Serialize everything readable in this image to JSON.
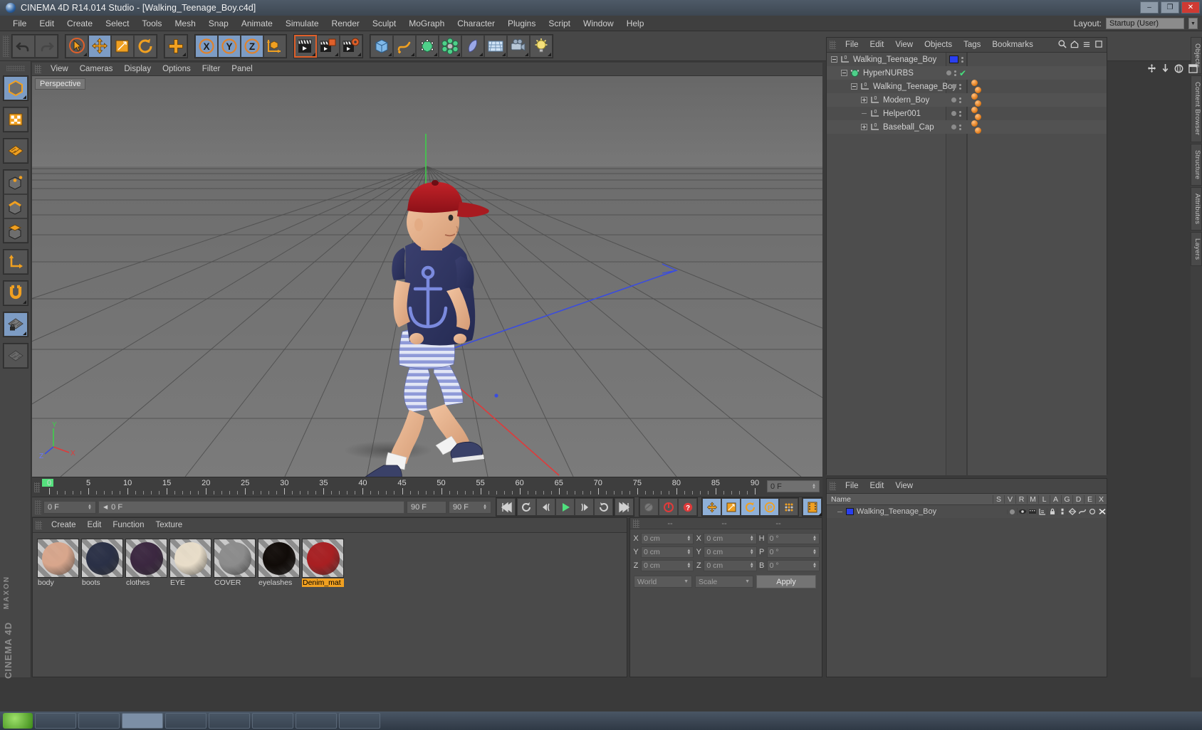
{
  "window": {
    "title": "CINEMA 4D R14.014 Studio - [Walking_Teenage_Boy.c4d]",
    "minimize": "–",
    "maximize": "❐",
    "close": "✕"
  },
  "menubar": {
    "items": [
      "File",
      "Edit",
      "Create",
      "Select",
      "Tools",
      "Mesh",
      "Snap",
      "Animate",
      "Simulate",
      "Render",
      "Sculpt",
      "MoGraph",
      "Character",
      "Plugins",
      "Script",
      "Window",
      "Help"
    ],
    "layout_label": "Layout:",
    "layout_value": "Startup (User)"
  },
  "toolbar": {
    "groups": [
      {
        "name": "history",
        "buttons": [
          {
            "name": "undo-button",
            "icon": "undo"
          },
          {
            "name": "redo-button",
            "icon": "redo"
          }
        ]
      },
      {
        "name": "transform",
        "buttons": [
          {
            "name": "live-selection-tool",
            "icon": "cursor",
            "state": "active"
          },
          {
            "name": "move-tool",
            "icon": "move",
            "state": "selected"
          },
          {
            "name": "scale-tool",
            "icon": "scale"
          },
          {
            "name": "rotate-tool",
            "icon": "rotate"
          }
        ]
      },
      {
        "name": "plus",
        "buttons": [
          {
            "name": "add-tool",
            "icon": "plus"
          }
        ]
      },
      {
        "name": "axis-locks",
        "buttons": [
          {
            "name": "lock-x-axis",
            "icon": "X",
            "state": "selected"
          },
          {
            "name": "lock-y-axis",
            "icon": "Y",
            "state": "selected"
          },
          {
            "name": "lock-z-axis",
            "icon": "Z",
            "state": "selected"
          },
          {
            "name": "world-object-coordinates",
            "icon": "axis-cube"
          }
        ]
      },
      {
        "name": "render",
        "buttons": [
          {
            "name": "render-view-button",
            "icon": "clapper",
            "state": "active"
          },
          {
            "name": "render-region-button",
            "icon": "clapper-region"
          },
          {
            "name": "render-settings-button",
            "icon": "clapper-gear"
          }
        ]
      },
      {
        "name": "objects",
        "buttons": [
          {
            "name": "add-cube-object",
            "icon": "cube"
          },
          {
            "name": "add-spline-object",
            "icon": "spline"
          },
          {
            "name": "add-hypernurbs-object",
            "icon": "nurbs-cube"
          },
          {
            "name": "add-array-object",
            "icon": "array"
          },
          {
            "name": "add-bend-deformer",
            "icon": "deformer"
          },
          {
            "name": "add-floor-object",
            "icon": "floor"
          },
          {
            "name": "add-camera-object",
            "icon": "camera"
          },
          {
            "name": "add-light-object",
            "icon": "light"
          }
        ]
      }
    ]
  },
  "lefttoolbar": {
    "groups": [
      [
        {
          "name": "model-mode",
          "icon": "cube-model",
          "state": "selected"
        }
      ],
      [
        {
          "name": "texture-mode",
          "icon": "checker"
        }
      ],
      [
        {
          "name": "workplane-mode",
          "icon": "grid-plane"
        }
      ],
      [
        {
          "name": "points-mode",
          "icon": "points"
        },
        {
          "name": "edges-mode",
          "icon": "edges"
        },
        {
          "name": "polygons-mode",
          "icon": "polygons"
        }
      ],
      [
        {
          "name": "enable-axis-modification",
          "icon": "axis"
        }
      ],
      [
        {
          "name": "enable-snapping",
          "icon": "magnet"
        }
      ],
      [
        {
          "name": "workplane-lock",
          "icon": "grid-lock",
          "state": "selected"
        }
      ],
      [
        {
          "name": "workplane-grid",
          "icon": "grid"
        }
      ]
    ]
  },
  "viewport": {
    "menus": [
      "View",
      "Cameras",
      "Display",
      "Options",
      "Filter",
      "Panel"
    ],
    "label": "Perspective",
    "icons": [
      "pan-icon",
      "zoom-icon",
      "orbit-icon",
      "maximize-viewport-icon"
    ],
    "axis_labels": {
      "x": "X",
      "y": "Y",
      "z": "Z"
    }
  },
  "object_manager": {
    "menus": [
      "File",
      "Edit",
      "View",
      "Objects",
      "Tags",
      "Bookmarks"
    ],
    "header_icons": [
      "search-icon",
      "home-icon",
      "collapse-icon",
      "menu-icon"
    ],
    "rows": [
      {
        "name": "Walking_Teenage_Boy",
        "depth": 0,
        "expander": "minus",
        "icon": "null",
        "color_swatch": "#2a3ff0",
        "tags": 0
      },
      {
        "name": "HyperNURBS",
        "depth": 1,
        "expander": "minus",
        "icon": "hypernurbs",
        "check": true,
        "tags": 0
      },
      {
        "name": "Walking_Teenage_Boy",
        "depth": 2,
        "expander": "minus",
        "icon": "null",
        "tags": 2
      },
      {
        "name": "Modern_Boy",
        "depth": 3,
        "expander": "plus",
        "icon": "null",
        "tags": 2
      },
      {
        "name": "Helper001",
        "depth": 3,
        "expander": "none",
        "icon": "null",
        "tags": 2
      },
      {
        "name": "Baseball_Cap",
        "depth": 3,
        "expander": "plus",
        "icon": "null",
        "tags": 2
      }
    ]
  },
  "layer_manager": {
    "menus": [
      "File",
      "Edit",
      "View"
    ],
    "columns": [
      "Name",
      "S",
      "V",
      "R",
      "M",
      "L",
      "A",
      "G",
      "D",
      "E",
      "X"
    ],
    "rows": [
      {
        "name": "Walking_Teenage_Boy",
        "color": "#2a3ff0"
      }
    ]
  },
  "timeline": {
    "ticks": [
      0,
      5,
      10,
      15,
      20,
      25,
      30,
      35,
      40,
      45,
      50,
      55,
      60,
      65,
      70,
      75,
      80,
      85,
      90
    ],
    "start": 0,
    "end": 90,
    "end_field": "0 F"
  },
  "animation_bar": {
    "current_frame": "0 F",
    "preview_range_start": "0 F",
    "preview_range_end": "90 F",
    "max_frame": "90 F",
    "buttons": [
      {
        "name": "go-to-start-button",
        "icon": "skip-back"
      },
      {
        "name": "play-backwards-button",
        "icon": "rewind"
      },
      {
        "name": "previous-frame-button",
        "icon": "step-back"
      },
      {
        "name": "play-button",
        "icon": "play"
      },
      {
        "name": "next-frame-button",
        "icon": "step-forward"
      },
      {
        "name": "play-forwards-button",
        "icon": "forward"
      },
      {
        "name": "go-to-end-button",
        "icon": "skip-forward"
      },
      {
        "name": "record-active-objects-button",
        "icon": "keyframe"
      },
      {
        "name": "autokeying-button",
        "icon": "autokey"
      },
      {
        "name": "keyframe-selection-button",
        "icon": "question"
      },
      {
        "name": "position-key-toggle",
        "icon": "move"
      },
      {
        "name": "scale-key-toggle",
        "icon": "scale"
      },
      {
        "name": "rotation-key-toggle",
        "icon": "rotate"
      },
      {
        "name": "parameter-key-toggle",
        "icon": "param"
      },
      {
        "name": "point-level-animation-toggle",
        "icon": "pla"
      },
      {
        "name": "animation-layer-button",
        "icon": "film"
      }
    ]
  },
  "material_manager": {
    "menus": [
      "Create",
      "Edit",
      "Function",
      "Texture"
    ],
    "materials": [
      {
        "name": "body",
        "color": "#d8a68c",
        "selected": false
      },
      {
        "name": "boots",
        "color": "#2a3046",
        "selected": false
      },
      {
        "name": "clothes",
        "color": "#3b2740",
        "selected": false
      },
      {
        "name": "EYE",
        "color": "#e8ddc9",
        "selected": false
      },
      {
        "name": "COVER",
        "color": "#8c8c8c",
        "selected": false
      },
      {
        "name": "eyelashes",
        "color": "#100b08",
        "selected": false
      },
      {
        "name": "Denim_mat",
        "color": "#a81f22",
        "selected": true
      }
    ]
  },
  "coordinate_manager": {
    "headers": [
      "--",
      "--",
      "--"
    ],
    "rows": [
      {
        "label1": "X",
        "value1": "0 cm",
        "label2": "X",
        "value2": "0 cm",
        "label3": "H",
        "value3": "0 °"
      },
      {
        "label1": "Y",
        "value1": "0 cm",
        "label2": "Y",
        "value2": "0 cm",
        "label3": "P",
        "value3": "0 °"
      },
      {
        "label1": "Z",
        "value1": "0 cm",
        "label2": "Z",
        "value2": "0 cm",
        "label3": "B",
        "value3": "0 °"
      }
    ],
    "system_dropdown": "World",
    "mode_dropdown": "Scale",
    "apply_button": "Apply"
  },
  "right_dock": {
    "tabs": [
      "Objects",
      "Content Browser",
      "Structure",
      "Attributes",
      "Layers"
    ]
  },
  "watermark": "CINEMA 4D",
  "watermark_top": "MAXON"
}
